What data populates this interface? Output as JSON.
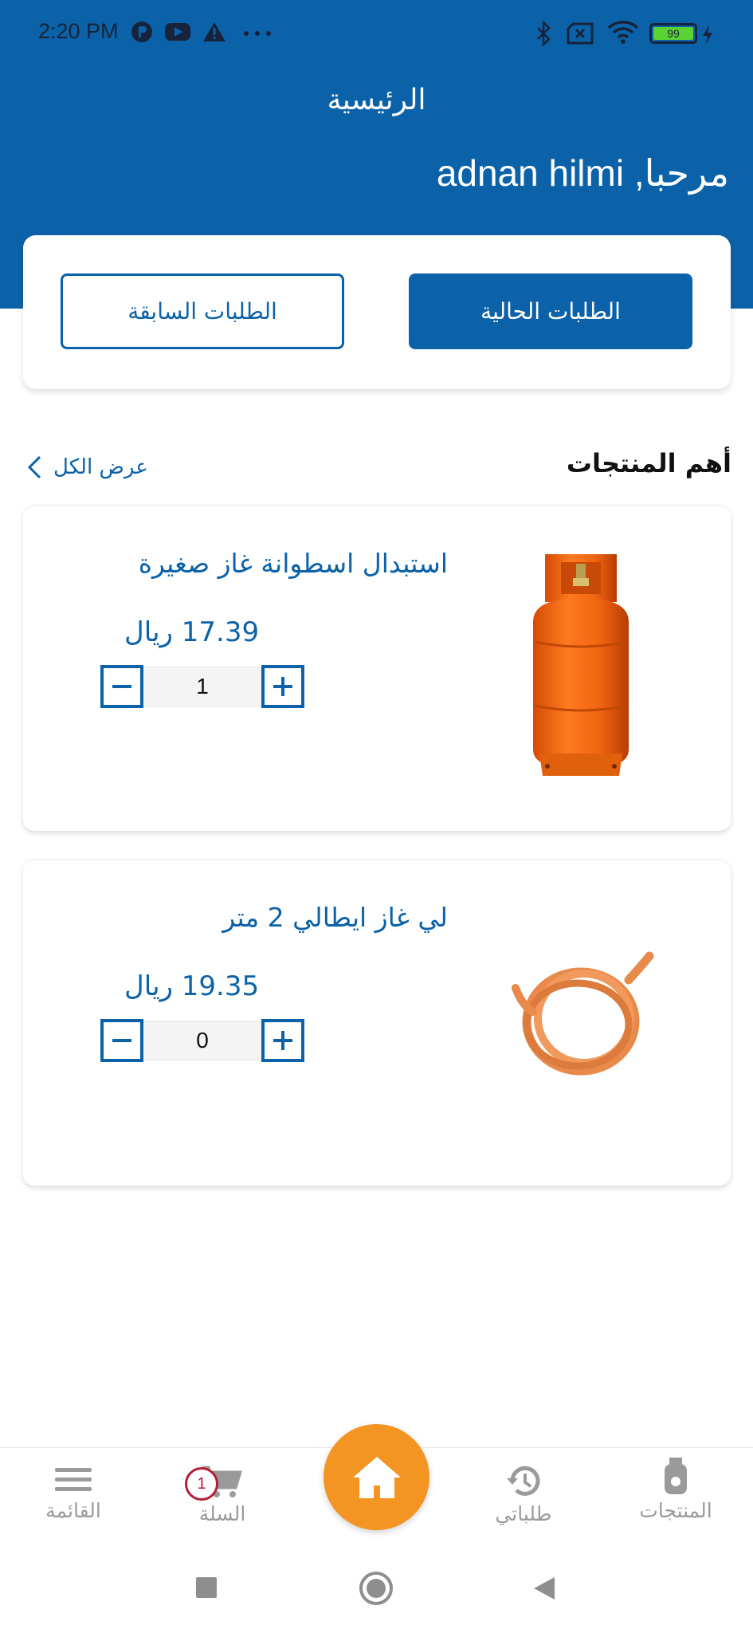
{
  "status_bar": {
    "time": "2:20 PM",
    "battery": "99",
    "icons": [
      "p-circle-icon",
      "youtube-icon",
      "warning-icon",
      "more-dots-icon",
      "bluetooth-icon",
      "sim-off-icon",
      "wifi-icon",
      "battery-icon",
      "charging-icon"
    ]
  },
  "header": {
    "title": "الرئيسية",
    "greeting": "مرحبا, adnan hilmi"
  },
  "orders": {
    "current_label": "الطلبات الحالية",
    "past_label": "الطلبات السابقة"
  },
  "top_products": {
    "title": "أهم المنتجات",
    "view_all": "عرض الكل"
  },
  "products": [
    {
      "name": "استبدال اسطوانة غاز صغيرة",
      "price": "17.39 ريال",
      "quantity": "1",
      "image": "gas-cylinder-image"
    },
    {
      "name": "لي غاز ايطالي  2 متر",
      "price": "19.35 ريال",
      "quantity": "0",
      "image": "gas-hose-image"
    }
  ],
  "bottom_nav": {
    "menu": "القائمة",
    "cart": "السلة",
    "cart_badge": "1",
    "my_orders": "طلباتي",
    "products": "المنتجات"
  },
  "colors": {
    "primary": "#0c62a8",
    "accent": "#f49422",
    "badge": "#b51d3a",
    "inactive": "#9a9a9a"
  }
}
